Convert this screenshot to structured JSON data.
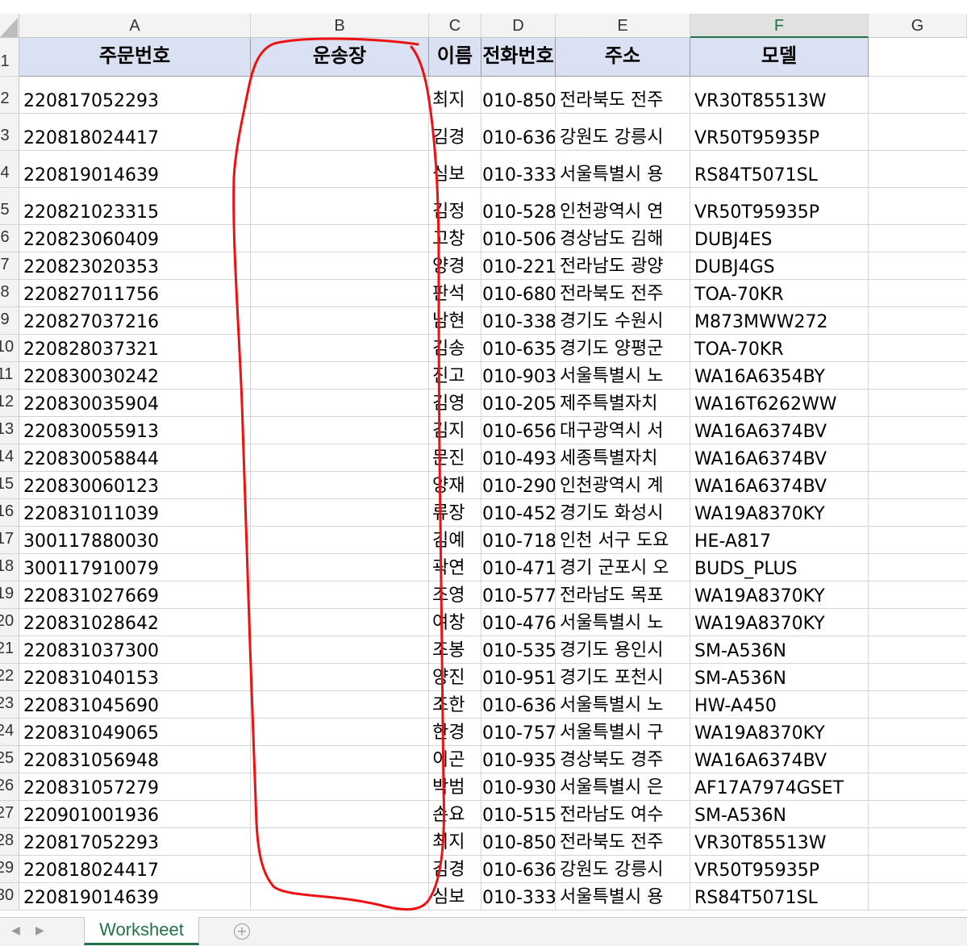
{
  "columns": [
    "A",
    "B",
    "C",
    "D",
    "E",
    "F",
    "G"
  ],
  "header_row": {
    "row_number": "1",
    "cells": [
      "주문번호",
      "운송장",
      "이름",
      "전화번호",
      "주소",
      "모델"
    ]
  },
  "rows": [
    {
      "n": "2",
      "a": "220817052293",
      "c": "최지",
      "d": "010-850",
      "e": "전라북도 전주",
      "f": "VR30T85513W"
    },
    {
      "n": "3",
      "a": "220818024417",
      "c": "김경",
      "d": "010-636",
      "e": "강원도 강릉시",
      "f": "VR50T95935P"
    },
    {
      "n": "4",
      "a": "220819014639",
      "c": "심보",
      "d": "010-333",
      "e": "서울특별시 용",
      "f": "RS84T5071SL"
    },
    {
      "n": "5",
      "a": "220821023315",
      "c": "김정",
      "d": "010-528",
      "e": "인천광역시 연",
      "f": "VR50T95935P"
    },
    {
      "n": "6",
      "a": "220823060409",
      "c": "고창",
      "d": "010-506",
      "e": "경상남도 김해",
      "f": "DUBJ4ES"
    },
    {
      "n": "7",
      "a": "220823020353",
      "c": "양경",
      "d": "010-221",
      "e": "전라남도 광양",
      "f": "DUBJ4GS"
    },
    {
      "n": "8",
      "a": "220827011756",
      "c": "판석",
      "d": "010-680",
      "e": "전라북도 전주",
      "f": "TOA-70KR"
    },
    {
      "n": "9",
      "a": "220827037216",
      "c": "남현",
      "d": "010-338",
      "e": "경기도 수원시",
      "f": "M873MWW272"
    },
    {
      "n": "10",
      "a": "220828037321",
      "c": "김송",
      "d": "010-635",
      "e": "경기도 양평군",
      "f": "TOA-70KR"
    },
    {
      "n": "11",
      "a": "220830030242",
      "c": "진고",
      "d": "010-903",
      "e": "서울특별시 노",
      "f": "WA16A6354BY"
    },
    {
      "n": "12",
      "a": "220830035904",
      "c": "김영",
      "d": "010-205",
      "e": "제주특별자치",
      "f": "WA16T6262WW"
    },
    {
      "n": "13",
      "a": "220830055913",
      "c": "김지",
      "d": "010-656",
      "e": "대구광역시 서",
      "f": "WA16A6374BV"
    },
    {
      "n": "14",
      "a": "220830058844",
      "c": "문진",
      "d": "010-493",
      "e": "세종특별자치",
      "f": "WA16A6374BV"
    },
    {
      "n": "15",
      "a": "220830060123",
      "c": "양재",
      "d": "010-290",
      "e": "인천광역시 계",
      "f": "WA16A6374BV"
    },
    {
      "n": "16",
      "a": "220831011039",
      "c": "류장",
      "d": "010-452",
      "e": "경기도 화성시",
      "f": "WA19A8370KY"
    },
    {
      "n": "17",
      "a": "300117880030",
      "c": "김예",
      "d": "010-718",
      "e": "인천 서구 도요",
      "f": "HE-A817"
    },
    {
      "n": "18",
      "a": "300117910079",
      "c": "곽연",
      "d": "010-471",
      "e": "경기 군포시 오",
      "f": "BUDS_PLUS"
    },
    {
      "n": "19",
      "a": "220831027669",
      "c": "조영",
      "d": "010-577",
      "e": "전라남도 목포",
      "f": "WA19A8370KY"
    },
    {
      "n": "20",
      "a": "220831028642",
      "c": "여창",
      "d": "010-476",
      "e": "서울특별시 노",
      "f": "WA19A8370KY"
    },
    {
      "n": "21",
      "a": "220831037300",
      "c": "조봉",
      "d": "010-535",
      "e": "경기도 용인시",
      "f": "SM-A536N"
    },
    {
      "n": "22",
      "a": "220831040153",
      "c": "양진",
      "d": "010-951",
      "e": "경기도 포천시",
      "f": "SM-A536N"
    },
    {
      "n": "23",
      "a": "220831045690",
      "c": "조한",
      "d": "010-636",
      "e": "서울특별시 노",
      "f": "HW-A450"
    },
    {
      "n": "24",
      "a": "220831049065",
      "c": "한경",
      "d": "010-757",
      "e": "서울특별시 구",
      "f": "WA19A8370KY"
    },
    {
      "n": "25",
      "a": "220831056948",
      "c": "이곤",
      "d": "010-935",
      "e": "경상북도 경주",
      "f": "WA16A6374BV"
    },
    {
      "n": "26",
      "a": "220831057279",
      "c": "박범",
      "d": "010-930",
      "e": "서울특별시 은",
      "f": "AF17A7974GSET"
    },
    {
      "n": "27",
      "a": "220901001936",
      "c": "손요",
      "d": "010-515",
      "e": "전라남도 여수",
      "f": "SM-A536N"
    },
    {
      "n": "28",
      "a": "220817052293",
      "c": "최지",
      "d": "010-850",
      "e": "전라북도 전주",
      "f": "VR30T85513W"
    },
    {
      "n": "29",
      "a": "220818024417",
      "c": "김경",
      "d": "010-636",
      "e": "강원도 강릉시",
      "f": "VR50T95935P"
    },
    {
      "n": "30",
      "a": "220819014639",
      "c": "심보",
      "d": "010-333",
      "e": "서울특별시 용",
      "f": "RS84T5071SL"
    }
  ],
  "sheet_tab": "Worksheet",
  "colors": {
    "header_fill": "#d9e1f2",
    "tab_green": "#217346",
    "annotation": "#ee1111"
  }
}
